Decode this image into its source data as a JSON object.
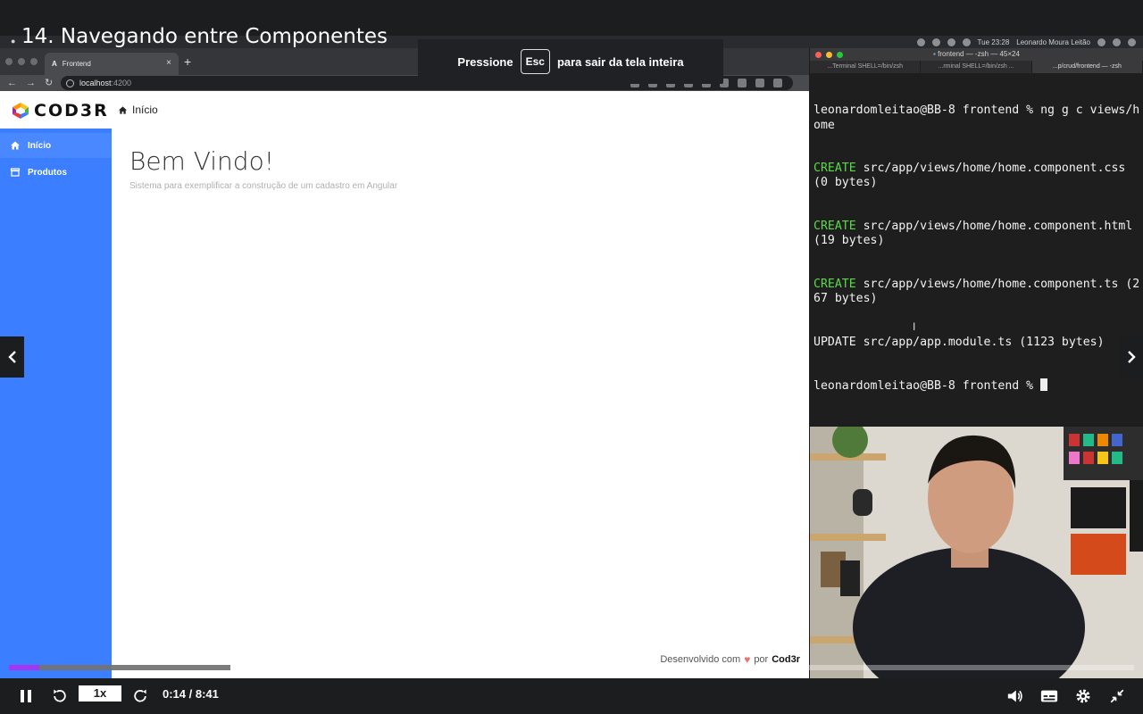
{
  "lesson": {
    "title": "14. Navegando entre Componentes"
  },
  "macbar": {
    "clock": "Tue 23:28",
    "user": "Leonardo Moura Leitão"
  },
  "browser": {
    "tab_title": "Frontend",
    "tab_favicon": "A",
    "url_host": "localhost",
    "url_port": ":4200"
  },
  "esc_overlay": {
    "before": "Pressione",
    "key": "Esc",
    "after": "para sair da tela inteira"
  },
  "app": {
    "logo_text": "COD3R",
    "header_nav": "Início",
    "sidebar": [
      {
        "label": "Início",
        "icon": "home-icon"
      },
      {
        "label": "Produtos",
        "icon": "store-icon"
      }
    ],
    "welcome_title": "Bem Vindo!",
    "welcome_subtitle": "Sistema para exemplificar a construção de um cadastro em Angular",
    "footer_prefix": "Desenvolvido com",
    "footer_mid": "por",
    "footer_brand": "Cod3r"
  },
  "terminal": {
    "window_title": "frontend — -zsh — 45×24",
    "tabs": [
      "...Terminal SHELL=/bin/zsh",
      "...rminal SHELL=/bin/zsh ...",
      "...p/crud/frontend — -zsh"
    ],
    "lines": [
      {
        "type": "prompt",
        "text": "leonardomleitao@BB-8 frontend % ng g c views/home"
      },
      {
        "type": "out",
        "label": "CREATE",
        "text": " src/app/views/home/home.component.css (0 bytes)"
      },
      {
        "type": "out",
        "label": "CREATE",
        "text": " src/app/views/home/home.component.html (19 bytes)"
      },
      {
        "type": "out",
        "label": "CREATE",
        "text": " src/app/views/home/home.component.ts (267 bytes)"
      },
      {
        "type": "plain",
        "text": "UPDATE src/app/app.module.ts (1123 bytes)"
      },
      {
        "type": "cursor",
        "text": "leonardomleitao@BB-8 frontend % "
      }
    ]
  },
  "player": {
    "speed": "1x",
    "time": "0:14 / 8:41",
    "played_fraction": 0.027,
    "buffered_fraction": 0.197,
    "accent": "#a435f0"
  }
}
